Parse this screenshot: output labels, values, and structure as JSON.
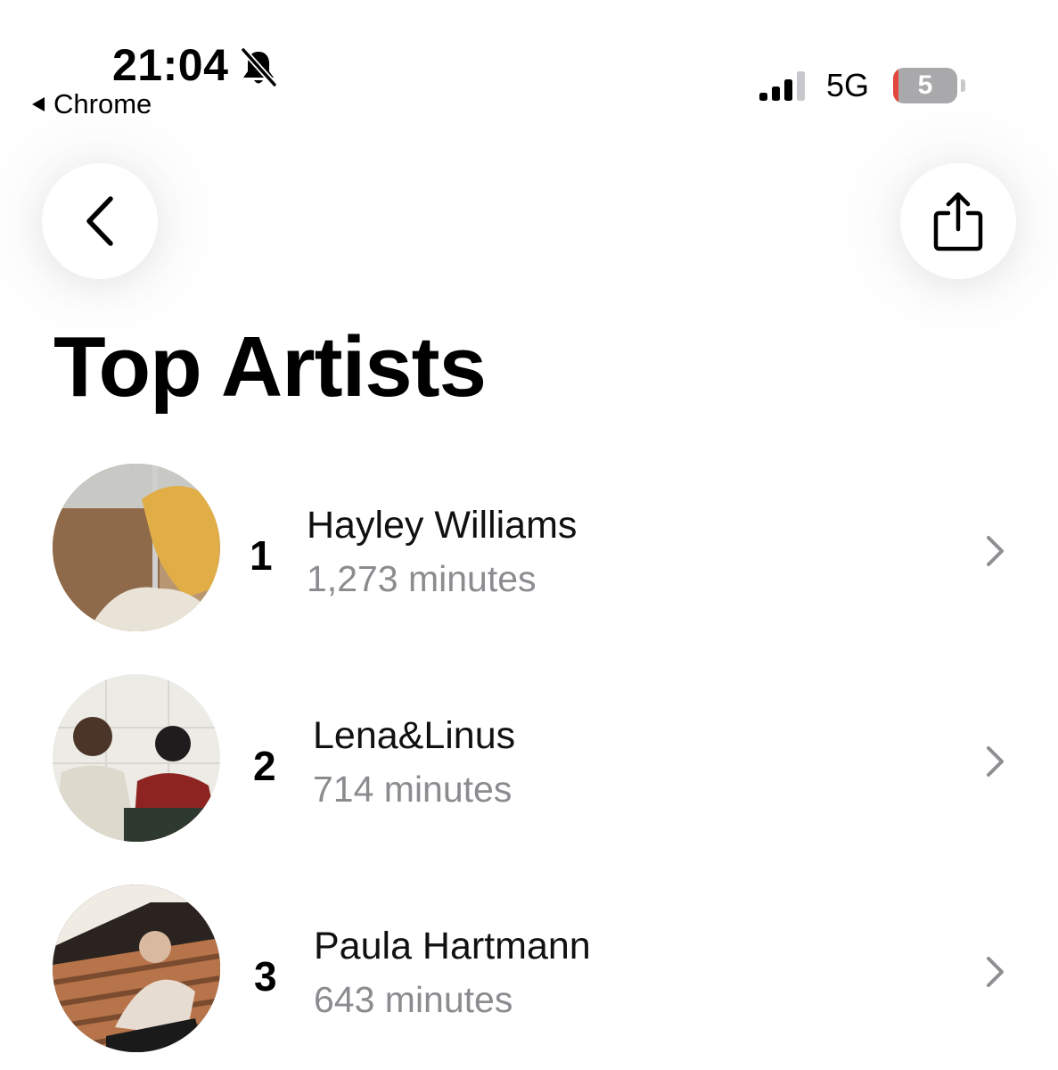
{
  "status_bar": {
    "time": "21:04",
    "back_app": "Chrome",
    "network": "5G",
    "battery": "5"
  },
  "header": {
    "back_icon": "chevron-left-icon",
    "share_icon": "share-icon"
  },
  "title": "Top Artists",
  "artists": [
    {
      "rank": "1",
      "name": "Hayley Williams",
      "minutes": "1,273 minutes"
    },
    {
      "rank": "2",
      "name": "Lena&Linus",
      "minutes": "714 minutes"
    },
    {
      "rank": "3",
      "name": "Paula Hartmann",
      "minutes": "643 minutes"
    }
  ],
  "colors": {
    "secondary_text": "#8c8c90",
    "chevron": "#8e8e93",
    "battery_low": "#e4473d"
  }
}
